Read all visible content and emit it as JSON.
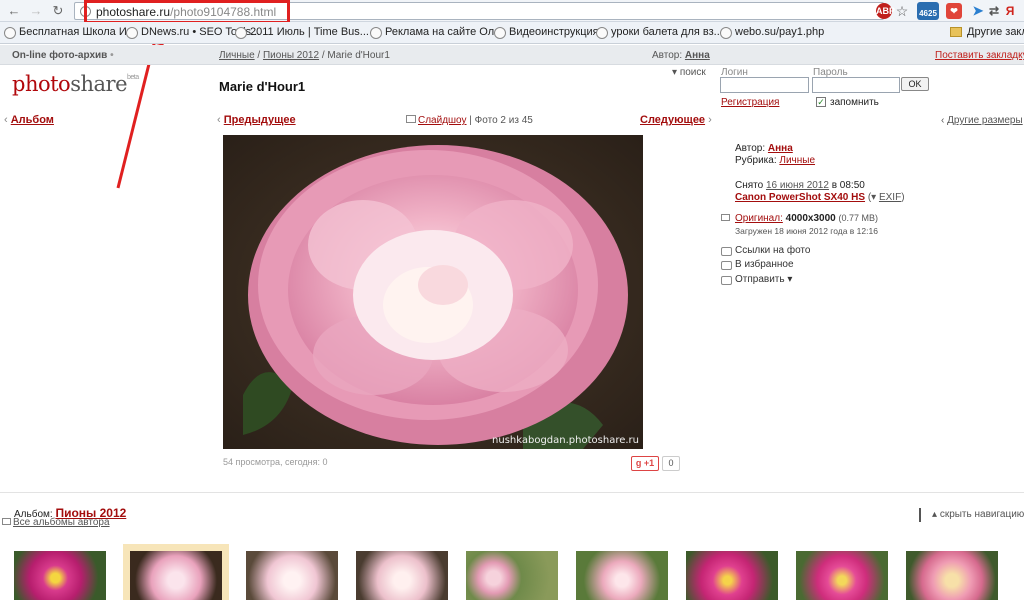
{
  "browser": {
    "url_host": "photoshare.ru",
    "url_path": "/photo9104788.html",
    "ext_badge": "4625",
    "bookmarks": [
      "Бесплатная Школа И...",
      "DNews.ru • SEO Tools...",
      "2011 Июль | Time Bus...",
      "Реклама на сайте Ол...",
      "Видеоинструкция",
      "уроки балета для вз...",
      "webo.su/pay1.php"
    ],
    "other_bookmarks": "Другие закладки"
  },
  "site": {
    "archive_label": "On-line фото-архив",
    "breadcrumb": [
      "Личные",
      "Пионы 2012",
      "Marie d'Hour1"
    ],
    "author_label": "Автор:",
    "author_name": "Анна",
    "bookmark_link": "Поставить закладку",
    "logo_a": "photo",
    "logo_b": "share",
    "logo_beta": "beta",
    "search_label": "поиск"
  },
  "login": {
    "login_label": "Логин",
    "password_label": "Пароль",
    "ok": "OK",
    "register": "Регистрация",
    "remember": "запомнить"
  },
  "photo": {
    "title": "Marie d'Hour1",
    "album_link": "Альбом",
    "prev": "Предыдущее",
    "next": "Следующее",
    "slideshow": "Слайдшоу",
    "counter": "Фото 2 из 45",
    "other_sizes": "Другие размеры",
    "watermark": "nushkabogdan.photoshare.ru",
    "views": "54 просмотра, сегодня: 0",
    "plus_one": "+1",
    "plus_count": "0"
  },
  "meta": {
    "author_k": "Автор:",
    "author_v": "Анна",
    "rubric_k": "Рубрика:",
    "rubric_v": "Личные",
    "shot_k": "Снято",
    "shot_date": "16 июня 2012",
    "shot_time": "в 08:50",
    "camera": "Canon PowerShot SX40 HS",
    "exif": "EXIF",
    "original_k": "Оригинал:",
    "original_size": "4000x3000",
    "original_mb": "(0.77 МВ)",
    "uploaded": "Загружен 18 июня 2012 года в 12:16",
    "links": "Ссылки на фото",
    "favorites": "В избранное",
    "send": "Отправить"
  },
  "album_nav": {
    "album_label": "Альбом:",
    "album_name": "Пионы 2012",
    "all_albums": "Все альбомы автора",
    "hide_nav": "скрыть навигацию"
  },
  "colors": {
    "accent": "#a30d0d",
    "annotation": "#e02020"
  }
}
